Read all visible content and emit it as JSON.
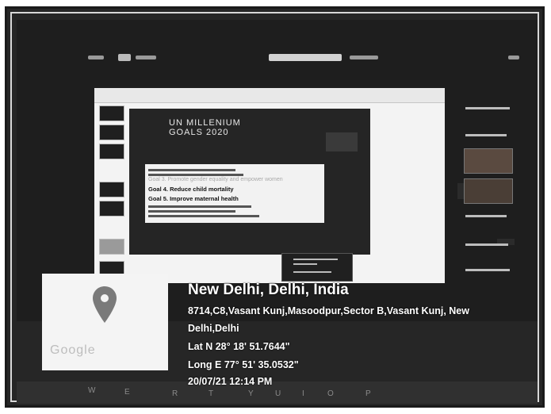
{
  "geotag": {
    "location_title": "New Delhi, Delhi, India",
    "address_line1": "8714,C8,Vasant Kunj,Masoodpur,Sector B,Vasant Kunj, New",
    "address_line2": "Delhi,Delhi",
    "latitude": "Lat N 28° 18' 51.7644\"",
    "longitude": "Long E 77° 51' 35.0532\"",
    "datetime": "20/07/21 12:14 PM",
    "map_logo_text": "Google"
  },
  "slide": {
    "title_line1": "UN MILLENIUM",
    "title_line2": "GOALS 2020",
    "goal4": "Goal 4. Reduce child mortality",
    "goal5": "Goal 5. Improve maternal health",
    "goal3_pale": "Goal 3. Promote gender equality and empower women"
  },
  "participants": {
    "names": [
      "BA/MC Ganesh...",
      "BA/MC Anil Ga...",
      "Raj Jwel Dhake...",
      "BA/MC Vishnu...",
      "BA/MC Kabir S..."
    ]
  },
  "keyboard": {
    "keys": [
      "W",
      "E",
      "R",
      "T",
      "Y",
      "U",
      "I",
      "O",
      "P"
    ]
  },
  "colors": {
    "pin": "#7a7a7a",
    "frame_bg": "#262626"
  }
}
